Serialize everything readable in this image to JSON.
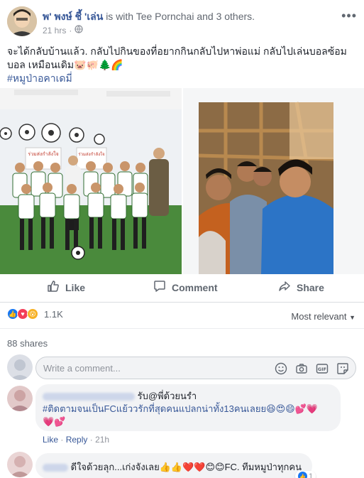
{
  "post": {
    "author": "พ' พงษ์ ชี้ 'เล่น",
    "with_text": "is with Tee Pornchai and 3 others.",
    "time": "21 hrs",
    "more": "•••",
    "text": "จะได้กลับบ้านแล้ว. กลับไปกินของที่อยากกินกลับไปหาพ่อแม่ กลับไปเล่นบอลซ้อมบอล เหมือนเดิม🐷🐖🌲🌈",
    "hashtag": "#หมูป่าอคาเดมี่",
    "banner_left": "ร่วมส่งกำลังใจ",
    "banner_right": "ร่วมส่งกำลังใจ"
  },
  "actions": {
    "like": "Like",
    "comment": "Comment",
    "share": "Share"
  },
  "reactions": {
    "count": "1.1K",
    "sort_label": "Most relevant"
  },
  "shares": "88 shares",
  "composer": {
    "placeholder": "Write a comment..."
  },
  "comments": [
    {
      "text_line1": "รับ@พี่ด้วยนรำ",
      "text_line2": "#ติดตามจนเป็นFCแย้ววรักที่สุดคนแปลกน่าทั้ง13คนเลยย😆😍😄💕💗",
      "text_line3": "💗💕",
      "like": "Like",
      "reply": "Reply",
      "time": "21h"
    },
    {
      "text": "ดีใจด้วยลุก...เก่งจังเลย👍👍❤️❤️😊😊FC. ทีมหมูป่าทุกคน",
      "like_count": "1"
    }
  ],
  "colors": {
    "link": "#385898",
    "muted": "#90949c",
    "action": "#606770"
  }
}
